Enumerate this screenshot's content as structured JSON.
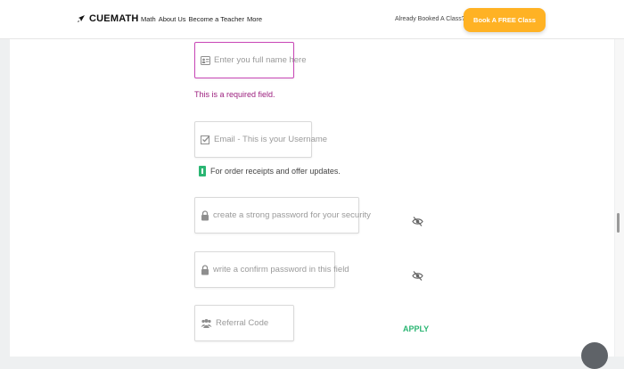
{
  "brand": {
    "logo_text": "CUEMATH",
    "accent": "#ffb224",
    "error_color": "#c846b6",
    "success_color": "#2bb673"
  },
  "header": {
    "nav": [
      "Math",
      "About Us",
      "Become a Teacher",
      "More"
    ],
    "already_text": "Already Booked A Class?",
    "cta_label": "Book A FREE Class"
  },
  "form": {
    "name": {
      "placeholder": "Enter you full name here",
      "icon": "id-card-icon",
      "error": "This is a required field."
    },
    "email": {
      "placeholder": "Email - This is your Username",
      "icon": "checkbox-icon",
      "hint": "For order receipts and offer updates."
    },
    "password": {
      "placeholder": "create a strong password for your security",
      "icon": "lock-icon"
    },
    "confirm_password": {
      "placeholder": "write a confirm password in this field",
      "icon": "lock-icon"
    },
    "referral": {
      "placeholder": "Referral Code",
      "icon": "users-icon",
      "apply_label": "APPLY"
    }
  }
}
